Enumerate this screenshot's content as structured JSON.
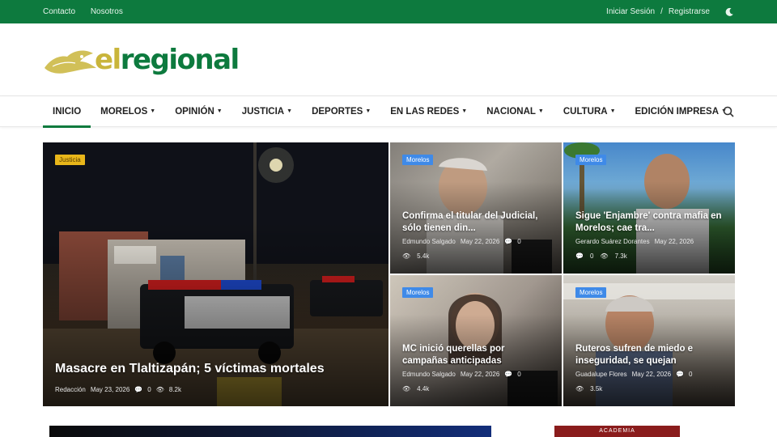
{
  "topbar": {
    "links": [
      "Contacto",
      "Nosotros"
    ],
    "login": "Iniciar Sesión",
    "separator": "/",
    "register": "Registrarse"
  },
  "logo": {
    "part1": "el",
    "part2": "regional"
  },
  "nav": {
    "items": [
      {
        "label": "INICIO",
        "caret": ""
      },
      {
        "label": "MORELOS",
        "caret": "▼"
      },
      {
        "label": "OPINIÓN",
        "caret": "▼"
      },
      {
        "label": "JUSTICIA",
        "caret": "▼"
      },
      {
        "label": "DEPORTES",
        "caret": "▼"
      },
      {
        "label": "EN LAS REDES",
        "caret": "▼"
      },
      {
        "label": "NACIONAL",
        "caret": "▼"
      },
      {
        "label": "CULTURA",
        "caret": "▼"
      },
      {
        "label": "EDICIÓN IMPRESA",
        "caret": "▼"
      }
    ]
  },
  "cards": [
    {
      "badge": "Justicia",
      "title": "Masacre en Tlaltizapán; 5 víctimas mortales",
      "author": "Redacción",
      "date": "May 23, 2026",
      "comments": "0",
      "views": "8.2k"
    },
    {
      "badge": "Morelos",
      "title": "Confirma el titular del Judicial, sólo tienen din...",
      "author": "Edmundo Salgado",
      "date": "May 22, 2026",
      "comments": "0",
      "views": "5.4k"
    },
    {
      "badge": "Morelos",
      "title": "Sigue 'Enjambre' contra mafia en Morelos; cae tra...",
      "author": "Gerardo Suárez Dorantes",
      "date": "May 22, 2026",
      "comments": "0",
      "views": "7.3k"
    },
    {
      "badge": "Morelos",
      "title": "MC inició querellas por campañas anticipadas",
      "author": "Edmundo Salgado",
      "date": "May 22, 2026",
      "comments": "0",
      "views": "4.4k"
    },
    {
      "badge": "Morelos",
      "title": "Ruteros sufren de miedo e inseguridad, se quejan",
      "author": "Guadalupe Flores",
      "date": "May 22, 2026",
      "comments": "0",
      "views": "3.5k"
    }
  ],
  "ads": {
    "right_label": "ACADEMIA"
  },
  "colors": {
    "brand_green": "#0d7a3e",
    "logo_gold": "#c9b53b",
    "badge_blue": "#3f8ae8",
    "badge_yellow": "#e8b61a"
  }
}
